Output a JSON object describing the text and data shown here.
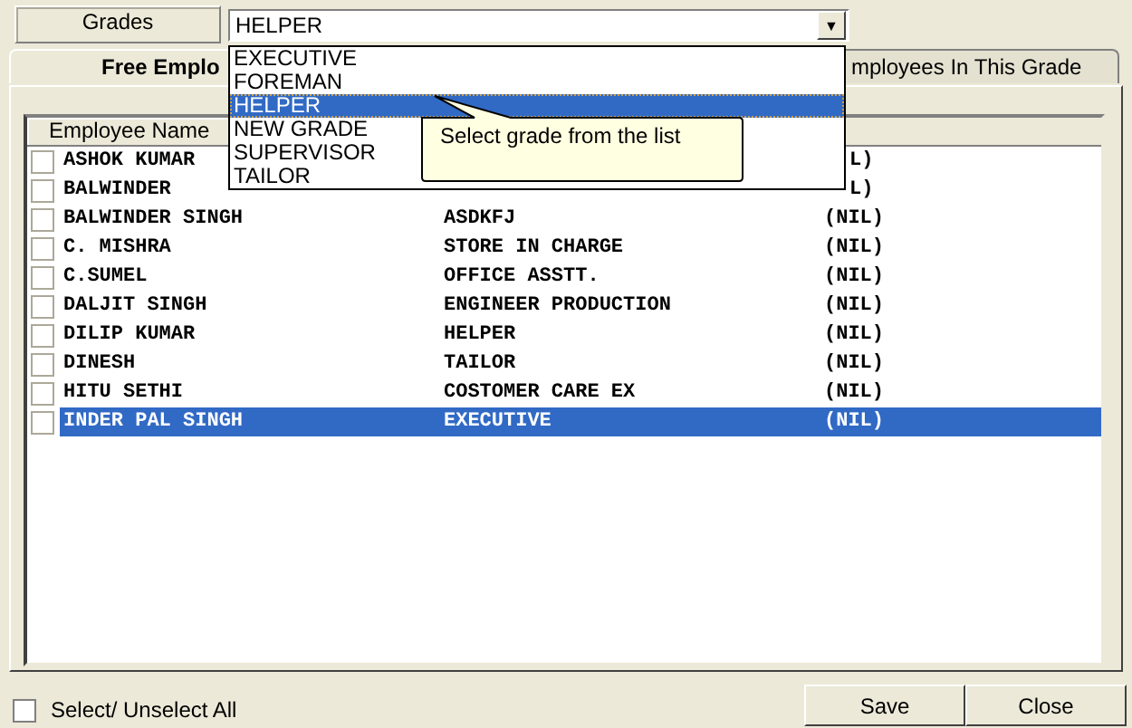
{
  "grades": {
    "label": "Grades",
    "value": "HELPER",
    "arrow": "▼",
    "options": [
      {
        "label": "EXECUTIVE",
        "selected": false
      },
      {
        "label": "FOREMAN",
        "selected": false
      },
      {
        "label": "HELPER",
        "selected": true
      },
      {
        "label": "NEW GRADE",
        "selected": false
      },
      {
        "label": "SUPERVISOR",
        "selected": false
      },
      {
        "label": "TAILOR",
        "selected": false
      }
    ],
    "tooltip": "Select grade from the list"
  },
  "tabs": [
    {
      "label": "Free Emplo",
      "selected": true
    },
    {
      "label": "mployees In This Grade",
      "selected": false
    }
  ],
  "table": {
    "columns": [
      "Employee Name"
    ],
    "rows": [
      {
        "checked": false,
        "selected": false,
        "name": "ASHOK KUMAR",
        "column_3": "L)"
      },
      {
        "checked": false,
        "selected": false,
        "name": "BALWINDER",
        "column_3": "L)"
      },
      {
        "checked": false,
        "selected": false,
        "name": "BALWINDER SINGH",
        "designation": "ASDKFJ",
        "column_3": "(NIL)"
      },
      {
        "checked": false,
        "selected": false,
        "name": "C. MISHRA",
        "designation": "STORE IN CHARGE",
        "column_3": "(NIL)"
      },
      {
        "checked": false,
        "selected": false,
        "name": "C.SUMEL",
        "designation": "OFFICE ASSTT.",
        "column_3": "(NIL)"
      },
      {
        "checked": false,
        "selected": false,
        "name": "DALJIT SINGH",
        "designation": "ENGINEER PRODUCTION",
        "column_3": "(NIL)"
      },
      {
        "checked": false,
        "selected": false,
        "name": "DILIP KUMAR",
        "designation": "HELPER",
        "column_3": "(NIL)"
      },
      {
        "checked": false,
        "selected": false,
        "name": "DINESH",
        "designation": "TAILOR",
        "column_3": "(NIL)"
      },
      {
        "checked": false,
        "selected": false,
        "name": "HITU SETHI",
        "designation": "COSTOMER CARE EX",
        "column_3": "(NIL)"
      },
      {
        "checked": false,
        "selected": true,
        "name": "INDER PAL SINGH",
        "designation": "EXECUTIVE",
        "column_3": "(NIL)"
      }
    ]
  },
  "select_all": {
    "label": "Select/ Unselect All",
    "checked": false
  },
  "buttons": [
    "Save",
    "Close"
  ]
}
